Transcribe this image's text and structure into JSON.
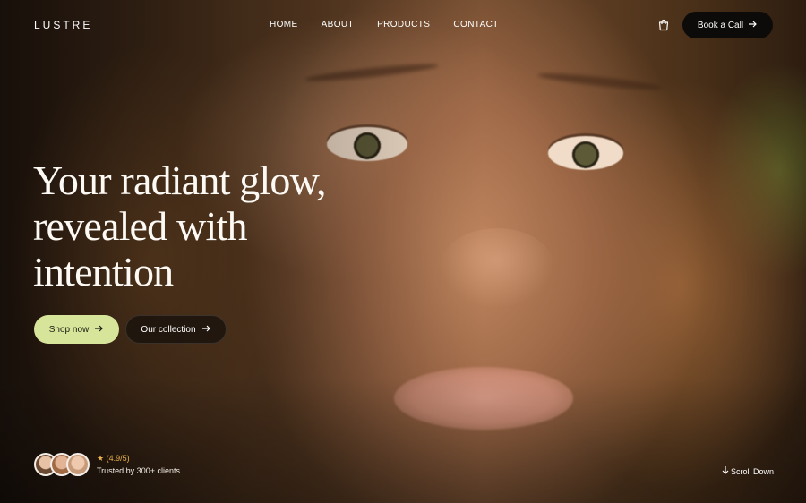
{
  "brand": {
    "logo": "LUSTRE"
  },
  "nav": {
    "items": [
      {
        "label": "HOME",
        "active": true
      },
      {
        "label": "ABOUT",
        "active": false
      },
      {
        "label": "PRODUCTS",
        "active": false
      },
      {
        "label": "CONTACT",
        "active": false
      }
    ]
  },
  "header": {
    "cart_icon": "shopping-bag-icon",
    "book_call_label": "Book a Call",
    "book_call_icon": "arrow-right-icon"
  },
  "hero": {
    "headline_line1": "Your radiant glow,",
    "headline_line2": "revealed with",
    "headline_line3": "intention",
    "primary_cta_label": "Shop now",
    "secondary_cta_label": "Our collection",
    "cta_icon": "arrow-right-icon"
  },
  "trust": {
    "rating_text": "★ (4.9/5)",
    "trusted_text": "Trusted by 300+ clients",
    "avatar_count": 3
  },
  "scroll": {
    "label": "Scroll Down",
    "icon": "arrow-down-icon"
  },
  "colors": {
    "primary_button": "#d7e59a",
    "dark_button": "#0d0b0a",
    "rating_star": "#e9b24f"
  }
}
